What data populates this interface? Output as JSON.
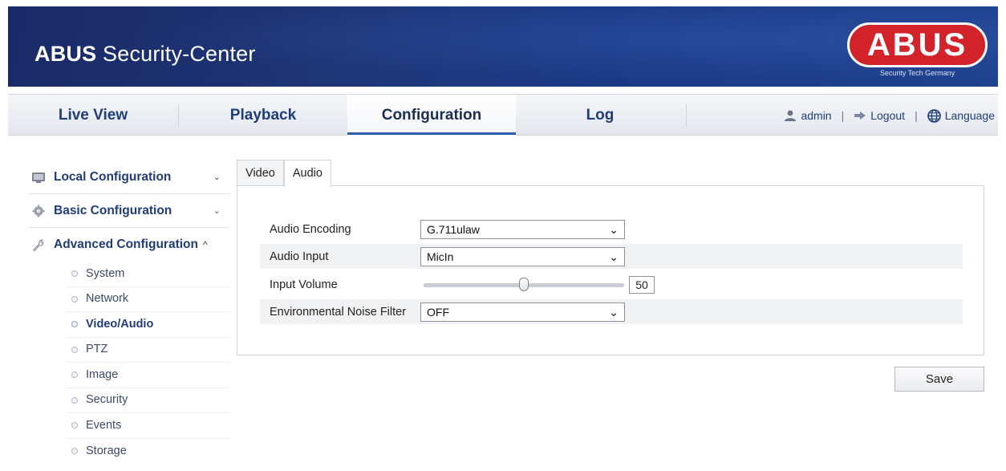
{
  "header": {
    "app_title_brand": "ABUS",
    "app_title_rest": " Security-Center",
    "logo_text": "ABUS",
    "logo_tagline": "Security Tech Germany",
    "brand_color": "#d3232a"
  },
  "nav": {
    "tabs": [
      {
        "label": "Live View"
      },
      {
        "label": "Playback"
      },
      {
        "label": "Configuration",
        "active": true
      },
      {
        "label": "Log"
      }
    ],
    "user": "admin",
    "logout": "Logout",
    "language": "Language",
    "separator": "|"
  },
  "sidebar": {
    "sections": [
      {
        "label": "Local Configuration",
        "icon": "monitor-icon",
        "expanded": false
      },
      {
        "label": "Basic Configuration",
        "icon": "gear-icon",
        "expanded": false
      },
      {
        "label": "Advanced Configuration",
        "icon": "wrench-icon",
        "expanded": true
      }
    ],
    "chevron_down": "⌄",
    "chevron_up": "^",
    "sub_items": [
      {
        "label": "System"
      },
      {
        "label": "Network"
      },
      {
        "label": "Video/Audio",
        "active": true
      },
      {
        "label": "PTZ"
      },
      {
        "label": "Image"
      },
      {
        "label": "Security"
      },
      {
        "label": "Events"
      },
      {
        "label": "Storage"
      }
    ]
  },
  "content": {
    "tabs": [
      {
        "label": "Video"
      },
      {
        "label": "Audio",
        "active": true
      }
    ],
    "fields": {
      "audio_encoding": {
        "label": "Audio Encoding",
        "value": "G.711ulaw"
      },
      "audio_input": {
        "label": "Audio Input",
        "value": "MicIn"
      },
      "input_volume": {
        "label": "Input Volume",
        "value": "50",
        "level": 0.5
      },
      "noise_filter": {
        "label": "Environmental Noise Filter",
        "value": "OFF"
      }
    },
    "save_label": "Save"
  }
}
